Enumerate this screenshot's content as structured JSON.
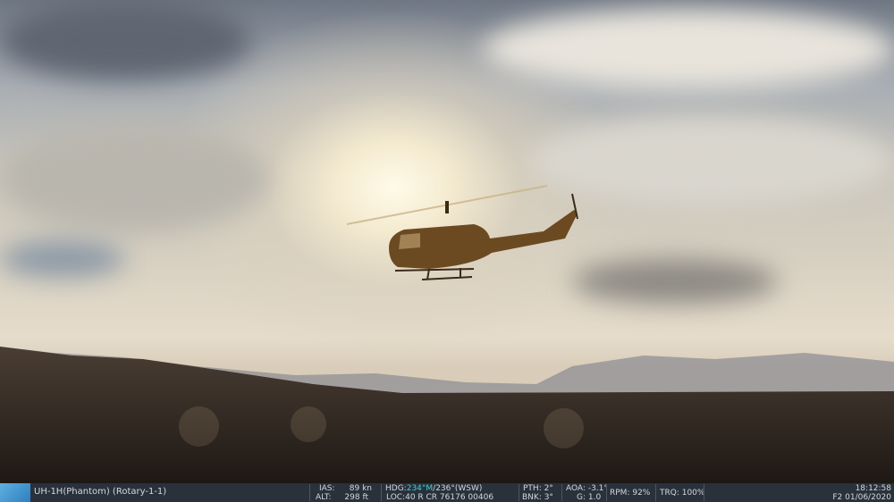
{
  "status_bar": {
    "unit": "UH-1H(Phantom) (Rotary-1-1)",
    "ias_label": "IAS:",
    "ias_value": "89 kn",
    "alt_label": "ALT:",
    "alt_value": "298 ft",
    "hdg_label": "HDG:",
    "hdg_magnetic": "234°M",
    "hdg_true": "/236°(WSW)",
    "loc": "LOC:40 R CR 76176 00406",
    "pth": "PTH: 2°",
    "bnk": "BNK: 3°",
    "aoa": "AOA: -3.1°",
    "g": "G: 1.0",
    "rpm": "RPM: 92%",
    "trq": "TRQ: 100%",
    "time": "18:12:58",
    "date": "F2 01/06/2020"
  },
  "colors": {
    "bar": "#29313b",
    "heading_accent": "#3fd0d8"
  }
}
